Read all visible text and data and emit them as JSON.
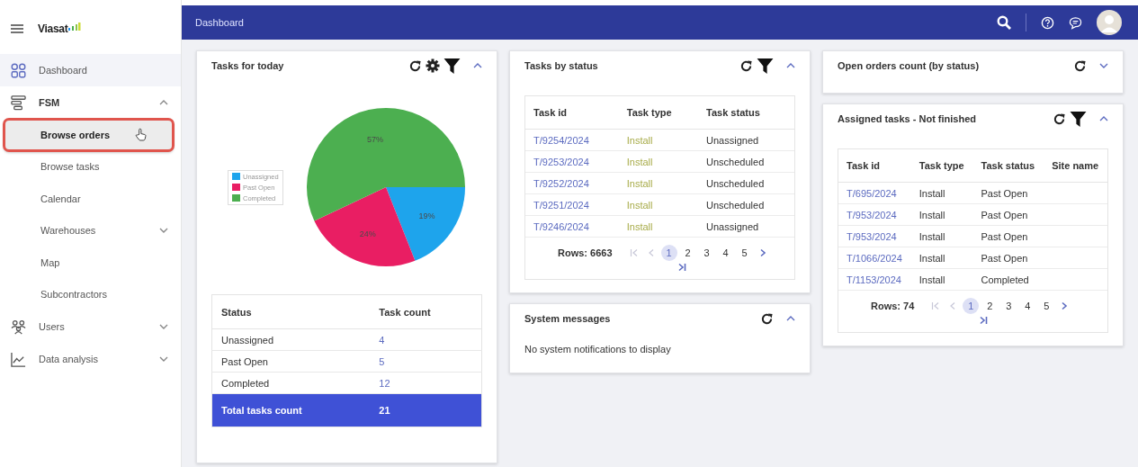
{
  "sidebar": {
    "logo": "Viasat",
    "items": [
      {
        "label": "Dashboard",
        "selected": true
      },
      {
        "label": "FSM",
        "selected": false,
        "expanded": true,
        "children": [
          {
            "label": "Browse orders",
            "highlighted": true
          },
          {
            "label": "Browse tasks",
            "highlighted": false
          },
          {
            "label": "Calendar",
            "highlighted": false
          },
          {
            "label": "Warehouses",
            "highlighted": false,
            "expanded": false
          },
          {
            "label": "Map",
            "highlighted": false
          },
          {
            "label": "Subcontractors",
            "highlighted": false
          }
        ]
      },
      {
        "label": "Users",
        "selected": false,
        "expanded": false
      },
      {
        "label": "Data analysis",
        "selected": false,
        "expanded": false
      }
    ]
  },
  "top_bar": {
    "title": "Dashboard"
  },
  "columns": [
    [
      {
        "kind": "pie",
        "title": "Tasks for today",
        "tools": [
          {
            "kind": "refresh"
          },
          {
            "kind": "settings"
          },
          {
            "kind": "filter"
          }
        ],
        "expanded": true,
        "chart_data": {
          "type": "pie",
          "categories": [
            "Unassigned",
            "Past Open",
            "Completed"
          ],
          "values": [
            19,
            24,
            57
          ],
          "colors": [
            "#1ea4ec",
            "#e91e63",
            "#4caf50"
          ],
          "legend": true,
          "data_labels": "value_labels",
          "value_labels": [
            "19%",
            "24%",
            "57%"
          ]
        },
        "table": {
          "columns": [
            "Status",
            "Task count"
          ],
          "rows": [
            [
              "Unassigned",
              "4"
            ],
            [
              "Past Open",
              "5"
            ],
            [
              "Completed",
              "12"
            ]
          ],
          "total": [
            "Total tasks count",
            "21"
          ]
        }
      }
    ],
    [
      {
        "kind": "table",
        "title": "Tasks by status",
        "tools": [
          {
            "kind": "refresh"
          },
          {
            "kind": "filter"
          }
        ],
        "expanded": true,
        "table": {
          "columns": [
            "Task id",
            "Task type",
            "Task status"
          ],
          "type_highlighted": true,
          "rows": [
            [
              "T/9254/2024",
              "Install",
              "Unassigned"
            ],
            [
              "T/9253/2024",
              "Install",
              "Unscheduled"
            ],
            [
              "T/9252/2024",
              "Install",
              "Unscheduled"
            ],
            [
              "T/9251/2024",
              "Install",
              "Unscheduled"
            ],
            [
              "T/9246/2024",
              "Install",
              "Unassigned"
            ]
          ],
          "pagination": {
            "rows": "Rows: 6663",
            "pages": [
              {
                "label": "1",
                "selected": true
              },
              {
                "label": "2",
                "selected": false
              },
              {
                "label": "3",
                "selected": false
              },
              {
                "label": "4",
                "selected": false
              },
              {
                "label": "5",
                "selected": false
              }
            ]
          }
        }
      },
      {
        "kind": "message",
        "title": "System messages",
        "tools": [
          {
            "kind": "refresh"
          }
        ],
        "expanded": true,
        "message": "No system notifications to display"
      }
    ],
    [
      {
        "kind": "empty",
        "title": "Open orders count (by status)",
        "tools": [
          {
            "kind": "refresh"
          }
        ],
        "expanded": false
      },
      {
        "kind": "table",
        "title": "Assigned tasks - Not finished",
        "tools": [
          {
            "kind": "refresh"
          },
          {
            "kind": "filter"
          }
        ],
        "expanded": true,
        "table": {
          "columns": [
            "Task id",
            "Task type",
            "Task status",
            "Site name"
          ],
          "type_highlighted": false,
          "rows": [
            [
              "T/695/2024",
              "Install",
              "Past Open"
            ],
            [
              "T/953/2024",
              "Install",
              "Past Open"
            ],
            [
              "T/953/2024",
              "Install",
              "Past Open"
            ],
            [
              "T/1066/2024",
              "Install",
              "Past Open"
            ],
            [
              "T/1153/2024",
              "Install",
              "Completed"
            ]
          ],
          "pagination": {
            "rows": "Rows: 74",
            "pages": [
              {
                "label": "1",
                "selected": true
              },
              {
                "label": "2",
                "selected": false
              },
              {
                "label": "3",
                "selected": false
              },
              {
                "label": "4",
                "selected": false
              },
              {
                "label": "5",
                "selected": false
              }
            ]
          }
        }
      }
    ]
  ]
}
